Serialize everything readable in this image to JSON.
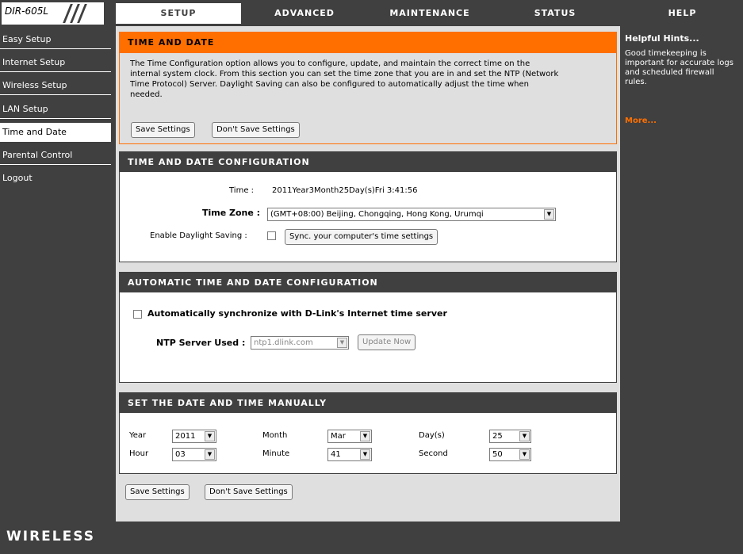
{
  "header": {
    "model": "DIR-605L",
    "tabs": [
      "SETUP",
      "ADVANCED",
      "MAINTENANCE",
      "STATUS",
      "HELP"
    ]
  },
  "sidebar": {
    "items": [
      "Easy Setup",
      "Internet Setup",
      "Wireless Setup",
      "LAN Setup",
      "Time and Date",
      "Parental Control",
      "Logout"
    ]
  },
  "intro": {
    "title": "TIME AND DATE",
    "text_line1": "The Time Configuration option allows you to configure, update, and maintain the correct time on the",
    "text_line2": "internal system clock. From this section you can set the time zone that you are in and set the NTP (Network",
    "text_line3": "Time Protocol) Server. Daylight Saving can also be configured to automatically adjust the time when",
    "text_line4": "needed.",
    "save_label": "Save Settings",
    "dont_save_label": "Don't Save Settings"
  },
  "config": {
    "title": "TIME AND DATE CONFIGURATION",
    "time_label": "Time  :",
    "time_value": "2011Year3Month25Day(s)Fri 3:41:56",
    "timezone_label": "Time Zone :",
    "timezone_value": "(GMT+08:00) Beijing, Chongqing, Hong Kong, Urumqi",
    "daylight_label": "Enable Daylight Saving  :",
    "sync_button": "Sync. your computer's time settings"
  },
  "auto": {
    "title": "AUTOMATIC TIME AND DATE CONFIGURATION",
    "auto_sync_label": "Automatically synchronize with D-Link's Internet time server",
    "ntp_label": "NTP Server Used :",
    "ntp_value": "ntp1.dlink.com",
    "update_button": "Update Now"
  },
  "manual": {
    "title": "SET THE DATE AND TIME MANUALLY",
    "year_label": "Year",
    "year_value": "2011",
    "month_label": "Month",
    "month_value": "Mar",
    "day_label": "Day(s)",
    "day_value": "25",
    "hour_label": "Hour",
    "hour_value": "03",
    "minute_label": "Minute",
    "minute_value": "41",
    "second_label": "Second",
    "second_value": "50"
  },
  "bottom": {
    "save_label": "Save Settings",
    "dont_save_label": "Don't Save Settings"
  },
  "help": {
    "title": "Helpful Hints...",
    "body": "Good timekeeping is important for accurate logs and scheduled firewall rules.",
    "more": "More..."
  },
  "footer": {
    "brand": "WIRELESS"
  },
  "colors": {
    "accent": "#ff6f00",
    "dark": "#404040",
    "panel": "#dfdfdf"
  }
}
